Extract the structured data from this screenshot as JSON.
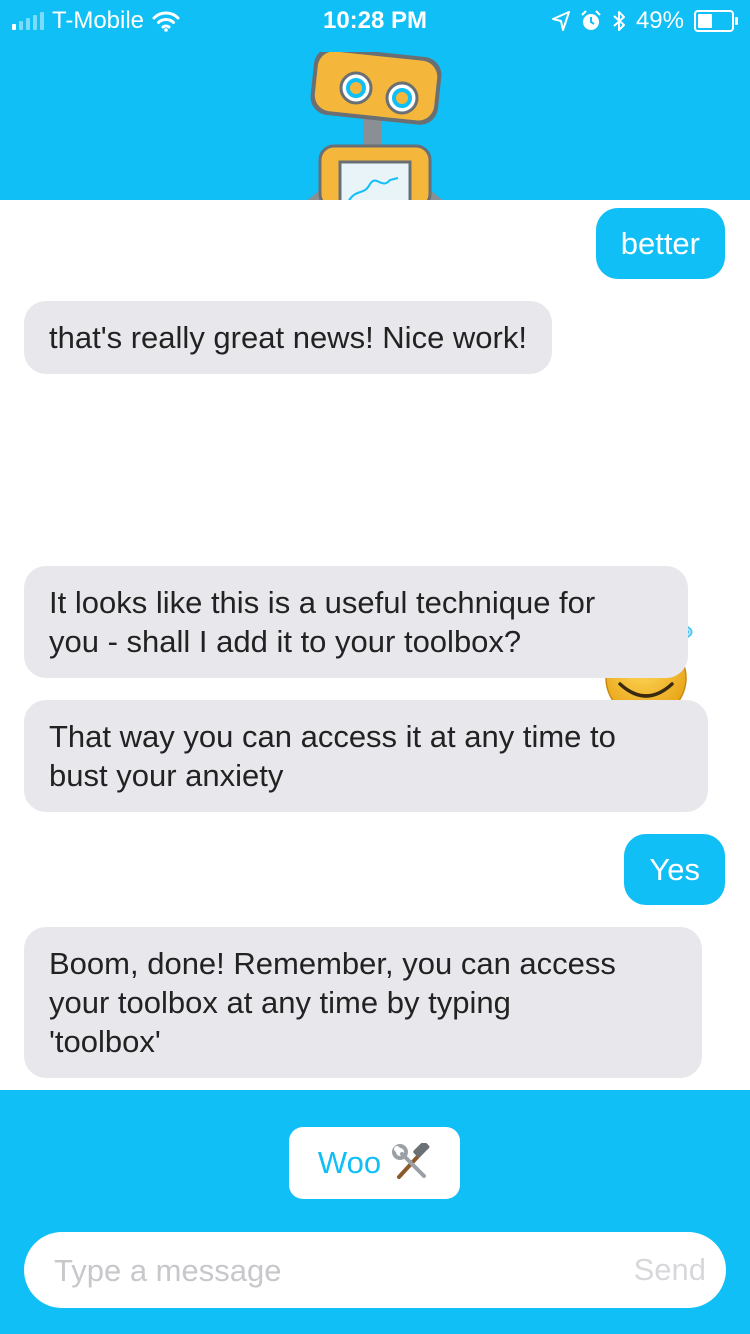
{
  "status_bar": {
    "carrier": "T-Mobile",
    "time": "10:28 PM",
    "battery_text": "49%",
    "battery_level": 0.49,
    "icons": [
      "signal-icon",
      "wifi-icon",
      "location-icon",
      "alarm-icon",
      "bluetooth-icon",
      "battery-icon"
    ]
  },
  "header": {
    "mascot": "robot-mascot"
  },
  "messages": [
    {
      "sender": "user",
      "text": "better"
    },
    {
      "sender": "bot",
      "text": "that's really great news! Nice work!"
    },
    {
      "sender": "user",
      "emoji": "smiling-face-with-halo"
    },
    {
      "sender": "bot",
      "line1": "It looks like this is a useful technique for",
      "line2": "you - shall I add it to your toolbox?"
    },
    {
      "sender": "bot",
      "line1": "That way you can access it at any time to",
      "line2": "bust your anxiety"
    },
    {
      "sender": "user",
      "text": "Yes"
    },
    {
      "sender": "bot",
      "line1": "Boom, done! Remember, you can access",
      "line2": "your toolbox at any time by typing",
      "line3": "'toolbox'"
    }
  ],
  "quick_reply": {
    "label": "Woo",
    "icon": "hammer-and-wrench-icon"
  },
  "composer": {
    "placeholder": "Type a message",
    "send_label": "Send"
  },
  "colors": {
    "accent": "#0fbff5",
    "bot_bubble": "#e8e8ec",
    "placeholder": "#c7c7cc"
  }
}
